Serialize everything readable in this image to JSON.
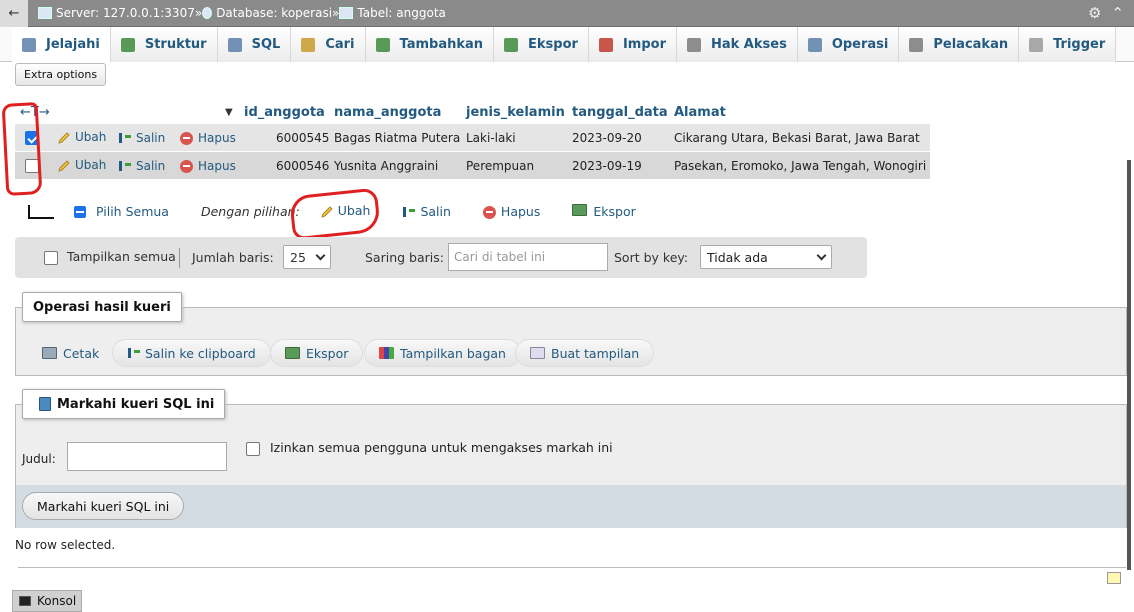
{
  "breadcrumb": {
    "back": "←",
    "server": "Server: 127.0.0.1:3307",
    "database": "Database: koperasi",
    "table": "Tabel: anggota",
    "sep": "»"
  },
  "tabs": [
    {
      "label": "Jelajahi",
      "icon": "browse-icon",
      "color": "#5a7fa8"
    },
    {
      "label": "Struktur",
      "icon": "structure-icon",
      "color": "#3d8a3d"
    },
    {
      "label": "SQL",
      "icon": "sql-icon",
      "color": "#5a7fa8"
    },
    {
      "label": "Cari",
      "icon": "search-icon",
      "color": "#c89a2a"
    },
    {
      "label": "Tambahkan",
      "icon": "insert-icon",
      "color": "#3d8a3d"
    },
    {
      "label": "Ekspor",
      "icon": "export-icon",
      "color": "#3d8a3d"
    },
    {
      "label": "Impor",
      "icon": "import-icon",
      "color": "#c0392b"
    },
    {
      "label": "Hak Akses",
      "icon": "privileges-icon",
      "color": "#7a7a7a"
    },
    {
      "label": "Operasi",
      "icon": "wrench-icon",
      "color": "#5a7fa8"
    },
    {
      "label": "Pelacakan",
      "icon": "eye-icon",
      "color": "#7a7a7a"
    },
    {
      "label": "Trigger",
      "icon": "trigger-icon",
      "color": "#9a9a9a"
    }
  ],
  "extra_options": "Extra options",
  "table": {
    "sort_arrows": "←T→",
    "columns": [
      "id_anggota",
      "nama_anggota",
      "jenis_kelamin",
      "tanggal_data",
      "Alamat"
    ],
    "row_actions": {
      "edit": "Ubah",
      "copy": "Salin",
      "delete": "Hapus"
    },
    "rows": [
      {
        "checked": true,
        "id": "6000545",
        "nama": "Bagas Riatma Putera",
        "jk": "Laki-laki",
        "tgl": "2023-09-20",
        "alamat": "Cikarang Utara, Bekasi Barat, Jawa Barat"
      },
      {
        "checked": false,
        "id": "6000546",
        "nama": "Yusnita Anggraini",
        "jk": "Perempuan",
        "tgl": "2023-09-19",
        "alamat": "Pasekan, Eromoko, Jawa Tengah, Wonogiri"
      }
    ]
  },
  "bulk": {
    "select_all": "Pilih Semua",
    "with_selected": "Dengan pilihan:",
    "edit": "Ubah",
    "copy": "Salin",
    "delete": "Hapus",
    "export": "Ekspor"
  },
  "controls": {
    "show_all": "Tampilkan semua",
    "rows_label": "Jumlah baris:",
    "rows_value": "25",
    "filter_label": "Saring baris:",
    "filter_placeholder": "Cari di tabel ini",
    "sort_label": "Sort by key:",
    "sort_value": "Tidak ada"
  },
  "query_ops": {
    "legend": "Operasi hasil kueri",
    "print": "Cetak",
    "copy_clipboard": "Salin ke clipboard",
    "export": "Ekspor",
    "chart": "Tampilkan bagan",
    "create_view": "Buat tampilan"
  },
  "bookmark": {
    "legend": "Markahi kueri SQL ini",
    "title_label": "Judul:",
    "share_label": "Izinkan semua pengguna untuk mengakses markah ini",
    "submit": "Markahi kueri SQL ini"
  },
  "status": "No row selected.",
  "console": "Konsol",
  "accent": "#235a81"
}
